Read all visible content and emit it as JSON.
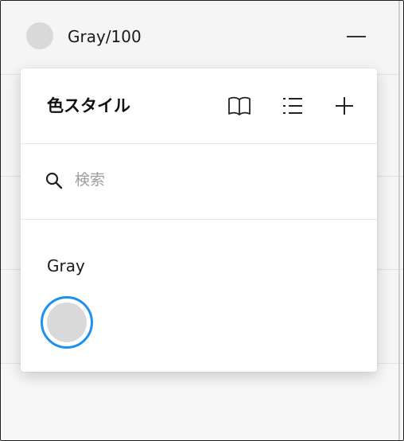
{
  "current_style": {
    "name": "Gray/100",
    "swatch_color": "#d9d9d9",
    "remove_icon": "minus-icon"
  },
  "popover": {
    "title": "色スタイル",
    "icons": [
      "book-icon",
      "list-icon",
      "plus-icon"
    ],
    "search": {
      "placeholder": "検索",
      "value": "",
      "icon": "search-icon"
    },
    "groups": [
      {
        "label": "Gray",
        "colors": [
          {
            "color": "#d9d9d9",
            "selected": true
          }
        ]
      }
    ]
  },
  "colors": {
    "selection_accent": "#1e90f0",
    "panel_background": "#f5f5f5"
  }
}
